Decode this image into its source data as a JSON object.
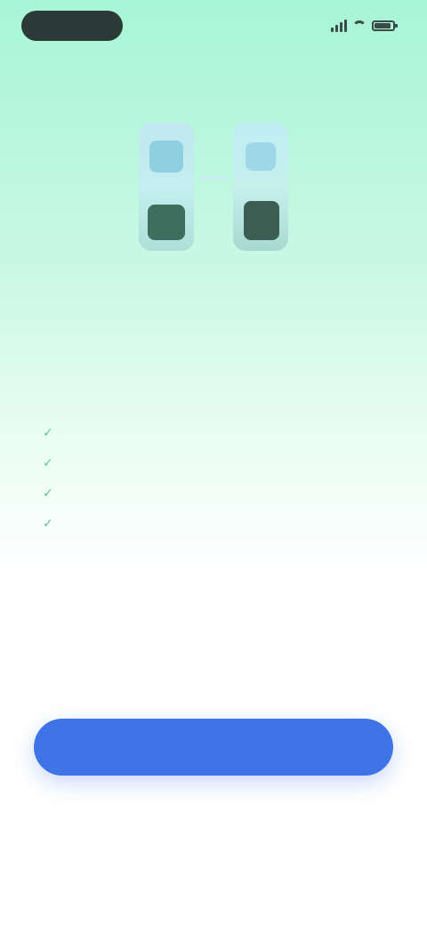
{
  "status_bar": {
    "time": "",
    "icons": [
      "signal-icon",
      "wifi-icon",
      "battery-icon"
    ]
  },
  "hero": {
    "icon": "two-phones-illustration"
  },
  "onboarding": {
    "title": "",
    "subtitle": "",
    "features": [
      {
        "icon": "check-icon",
        "text": ""
      },
      {
        "icon": "check-icon",
        "text": ""
      },
      {
        "icon": "check-icon",
        "text": ""
      },
      {
        "icon": "check-icon",
        "text": ""
      }
    ]
  },
  "actions": {
    "primary_label": "",
    "secondary_label": ""
  },
  "colors": {
    "gradient_top": "#a8f5d8",
    "accent": "#3f73e6",
    "check": "#5fbf99"
  }
}
